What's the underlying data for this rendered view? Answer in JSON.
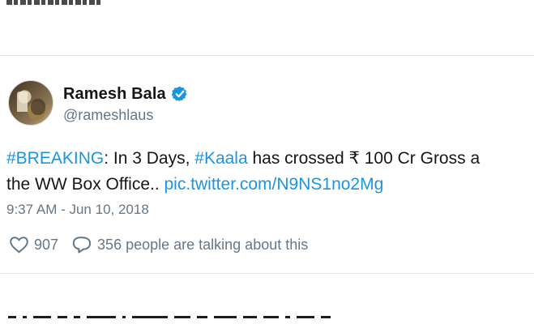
{
  "tweet": {
    "display_name": "Ramesh Bala",
    "handle": "@rameshlaus",
    "text": {
      "line1_prefix": "#BREAKING",
      "line1_mid": ": In 3 Days, ",
      "line1_hashtag": "#Kaala",
      "line1_suffix": " has crossed ₹ 100 Cr Gross a",
      "line2_prefix": "the WW Box Office.. ",
      "line2_link": "pic.twitter.com/N9NS1no2Mg"
    },
    "timestamp": "9:37 AM - Jun 10, 2018",
    "likes": "907",
    "replies_text": "356 people are talking about this"
  },
  "icons": {
    "verified": "verified-icon",
    "heart": "heart-icon",
    "reply": "reply-icon",
    "accent": "#1b95e0",
    "muted": "#657786",
    "border": "#e1e8ed"
  }
}
